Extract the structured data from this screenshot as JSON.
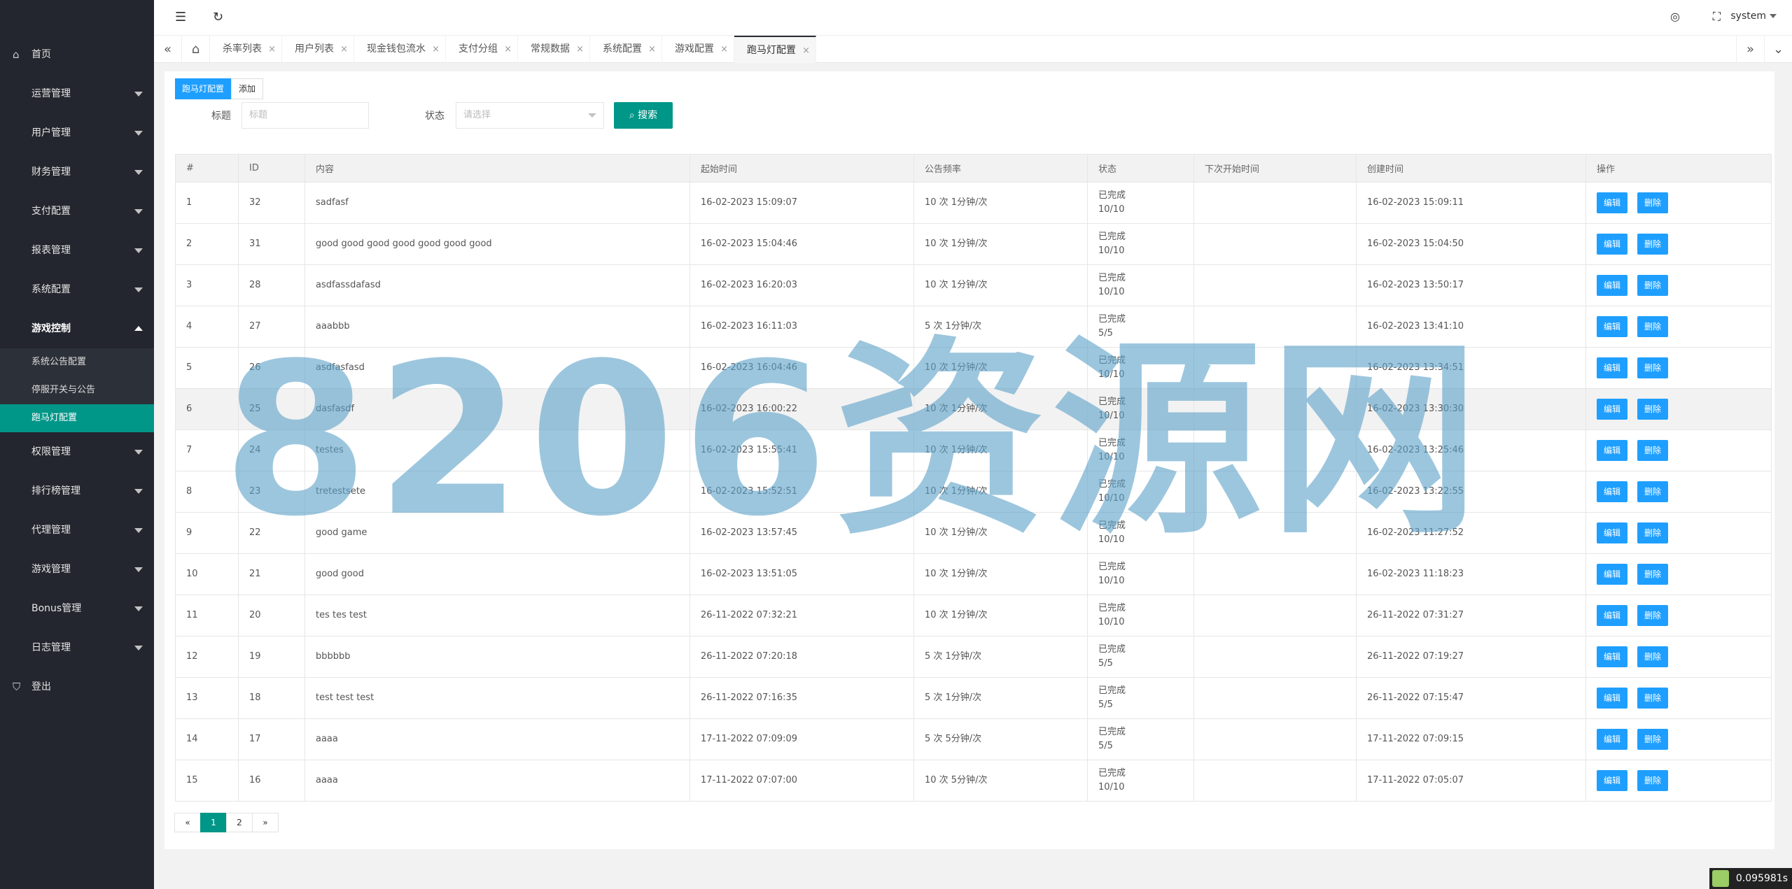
{
  "sidebar": {
    "home": "首页",
    "menu": [
      "运营管理",
      "用户管理",
      "财务管理",
      "支付配置",
      "报表管理",
      "系统配置"
    ],
    "game_control": "游戏控制",
    "sub": [
      "系统公告配置",
      "停服开关与公告",
      "跑马灯配置"
    ],
    "menu2": [
      "权限管理",
      "排行榜管理",
      "代理管理",
      "游戏管理",
      "Bonus管理",
      "日志管理"
    ],
    "logout": "登出"
  },
  "topbar": {
    "user": "system"
  },
  "tabs": [
    "杀率列表",
    "用户列表",
    "现金钱包流水",
    "支付分组",
    "常规数据",
    "系统配置",
    "游戏配置",
    "跑马灯配置"
  ],
  "toolbar": {
    "tab_active": "跑马灯配置",
    "add": "添加"
  },
  "filter": {
    "title_label": "标题",
    "title_placeholder": "标题",
    "status_label": "状态",
    "status_placeholder": "请选择",
    "search": "搜索"
  },
  "table": {
    "headers": [
      "#",
      "ID",
      "内容",
      "起始时间",
      "公告频率",
      "状态",
      "下次开始时间",
      "创建时间",
      "操作"
    ],
    "edit": "编辑",
    "del": "删除",
    "rows": [
      [
        "1",
        "32",
        "sadfasf",
        "16-02-2023 15:09:07",
        "10 次 1分钟/次",
        "已完成",
        "10/10",
        "",
        "16-02-2023 15:09:11"
      ],
      [
        "2",
        "31",
        "good good good good good good good",
        "16-02-2023 15:04:46",
        "10 次 1分钟/次",
        "已完成",
        "10/10",
        "",
        "16-02-2023 15:04:50"
      ],
      [
        "3",
        "28",
        "asdfassdafasd",
        "16-02-2023 16:20:03",
        "10 次 1分钟/次",
        "已完成",
        "10/10",
        "",
        "16-02-2023 13:50:17"
      ],
      [
        "4",
        "27",
        "aaabbb",
        "16-02-2023 16:11:03",
        "5 次 1分钟/次",
        "已完成",
        "5/5",
        "",
        "16-02-2023 13:41:10"
      ],
      [
        "5",
        "26",
        "asdfasfasd",
        "16-02-2023 16:04:46",
        "10 次 1分钟/次",
        "已完成",
        "10/10",
        "",
        "16-02-2023 13:34:51"
      ],
      [
        "6",
        "25",
        "dasfasdf",
        "16-02-2023 16:00:22",
        "10 次 1分钟/次",
        "已完成",
        "10/10",
        "",
        "16-02-2023 13:30:30"
      ],
      [
        "7",
        "24",
        "testes",
        "16-02-2023 15:55:41",
        "10 次 1分钟/次",
        "已完成",
        "10/10",
        "",
        "16-02-2023 13:25:46"
      ],
      [
        "8",
        "23",
        "tretestsete",
        "16-02-2023 15:52:51",
        "10 次 1分钟/次",
        "已完成",
        "10/10",
        "",
        "16-02-2023 13:22:55"
      ],
      [
        "9",
        "22",
        "good game",
        "16-02-2023 13:57:45",
        "10 次 1分钟/次",
        "已完成",
        "10/10",
        "",
        "16-02-2023 11:27:52"
      ],
      [
        "10",
        "21",
        "good good",
        "16-02-2023 13:51:05",
        "10 次 1分钟/次",
        "已完成",
        "10/10",
        "",
        "16-02-2023 11:18:23"
      ],
      [
        "11",
        "20",
        "tes tes test",
        "26-11-2022 07:32:21",
        "10 次 1分钟/次",
        "已完成",
        "10/10",
        "",
        "26-11-2022 07:31:27"
      ],
      [
        "12",
        "19",
        "bbbbbb",
        "26-11-2022 07:20:18",
        "5 次 1分钟/次",
        "已完成",
        "5/5",
        "",
        "26-11-2022 07:19:27"
      ],
      [
        "13",
        "18",
        "test test test",
        "26-11-2022 07:16:35",
        "5 次 1分钟/次",
        "已完成",
        "5/5",
        "",
        "26-11-2022 07:15:47"
      ],
      [
        "14",
        "17",
        "aaaa",
        "17-11-2022 07:09:09",
        "5 次 5分钟/次",
        "已完成",
        "5/5",
        "",
        "17-11-2022 07:09:15"
      ],
      [
        "15",
        "16",
        "aaaa",
        "17-11-2022 07:07:00",
        "10 次 5分钟/次",
        "已完成",
        "10/10",
        "",
        "17-11-2022 07:05:07"
      ]
    ]
  },
  "pager": {
    "prev": "«",
    "pages": [
      "1",
      "2"
    ],
    "next": "»"
  },
  "watermark": "8206资源网",
  "timer": "0.095981s"
}
